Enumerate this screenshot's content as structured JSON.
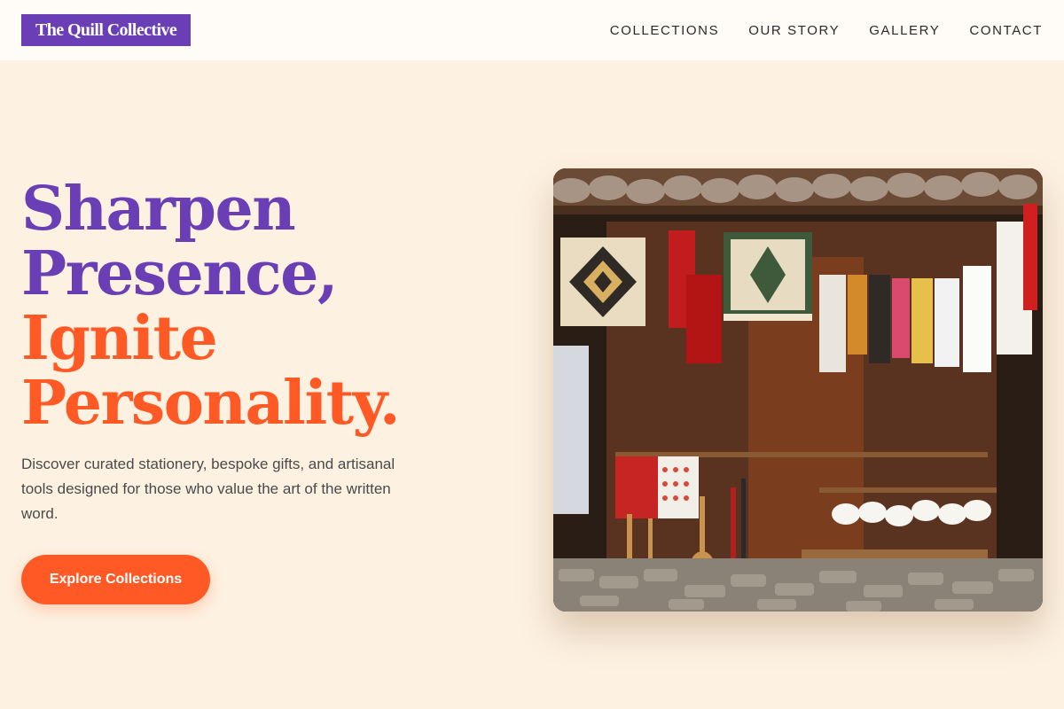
{
  "header": {
    "logo": "The Quill Collective",
    "nav": [
      "COLLECTIONS",
      "OUR STORY",
      "GALLERY",
      "CONTACT"
    ]
  },
  "hero": {
    "headline_lines": [
      "Sharpen",
      "Presence,",
      "Ignite",
      "Personality."
    ],
    "description": "Discover curated stationery, bespoke gifts, and artisanal tools designed for those who value the art of the written word.",
    "cta_label": "Explore Collections",
    "image_alt": "Market stall with hanging rugs, textiles, and handmade souvenirs"
  },
  "colors": {
    "brand_purple": "#6a3fb5",
    "accent_orange": "#ff5a26",
    "background": "#fdf1e1"
  }
}
